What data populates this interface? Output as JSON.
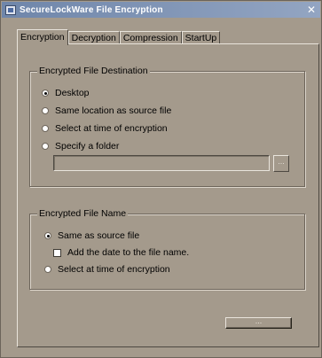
{
  "window": {
    "title": "SecureLockWare File Encryption",
    "close_glyph": "✕",
    "app_icon": "app-window-icon"
  },
  "tabs": [
    {
      "label": "Encryption",
      "active": true
    },
    {
      "label": "Decryption",
      "active": false
    },
    {
      "label": "Compression",
      "active": false
    },
    {
      "label": "StartUp",
      "active": false
    }
  ],
  "destination": {
    "title": "Encrypted File Destination",
    "options": [
      {
        "label": "Desktop",
        "checked": true
      },
      {
        "label": "Same location as source file",
        "checked": false
      },
      {
        "label": "Select at time of encryption",
        "checked": false
      },
      {
        "label": "Specify a folder",
        "checked": false
      }
    ],
    "folder_value": "",
    "browse_label": "..."
  },
  "file_name": {
    "title": "Encrypted File Name",
    "same_as_source": {
      "label": "Same as source file",
      "checked": true
    },
    "add_date": {
      "label": "Add the date to the file name.",
      "checked": false
    },
    "select_at_time": {
      "label": "Select at time of encryption",
      "checked": false
    }
  },
  "ok_button": {
    "label": "..."
  },
  "colors": {
    "window_bg": "#a49a8c",
    "titlebar_start": "#6f86aa",
    "titlebar_end": "#93a5c2"
  }
}
